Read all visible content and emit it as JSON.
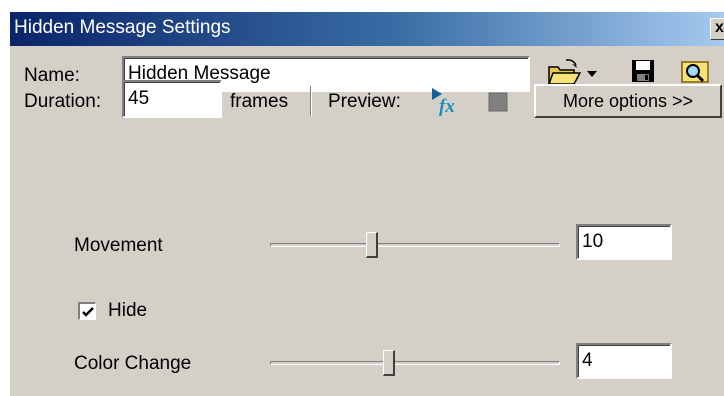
{
  "window": {
    "title": "Hidden Message Settings",
    "close_glyph": "x"
  },
  "name_row": {
    "label": "Name:",
    "value": "Hidden Message",
    "icons": [
      "open-folder-icon",
      "dropdown-arrow-icon",
      "save-disk-icon",
      "browse-search-icon"
    ]
  },
  "duration_row": {
    "label": "Duration:",
    "value": "45",
    "unit": "frames"
  },
  "preview": {
    "label": "Preview:",
    "icons": [
      "play-fx-icon",
      "stop-icon"
    ]
  },
  "more_options_label": "More options >>",
  "movement": {
    "label": "Movement",
    "value": "10",
    "slider_fraction": 0.35
  },
  "hide": {
    "label": "Hide",
    "checked": true
  },
  "color_change": {
    "label": "Color Change",
    "value": "4",
    "slider_fraction": 0.41
  },
  "colors": {
    "titlebar_start": "#0a246a",
    "titlebar_end": "#a6caf0",
    "panel": "#d4d0c8"
  }
}
